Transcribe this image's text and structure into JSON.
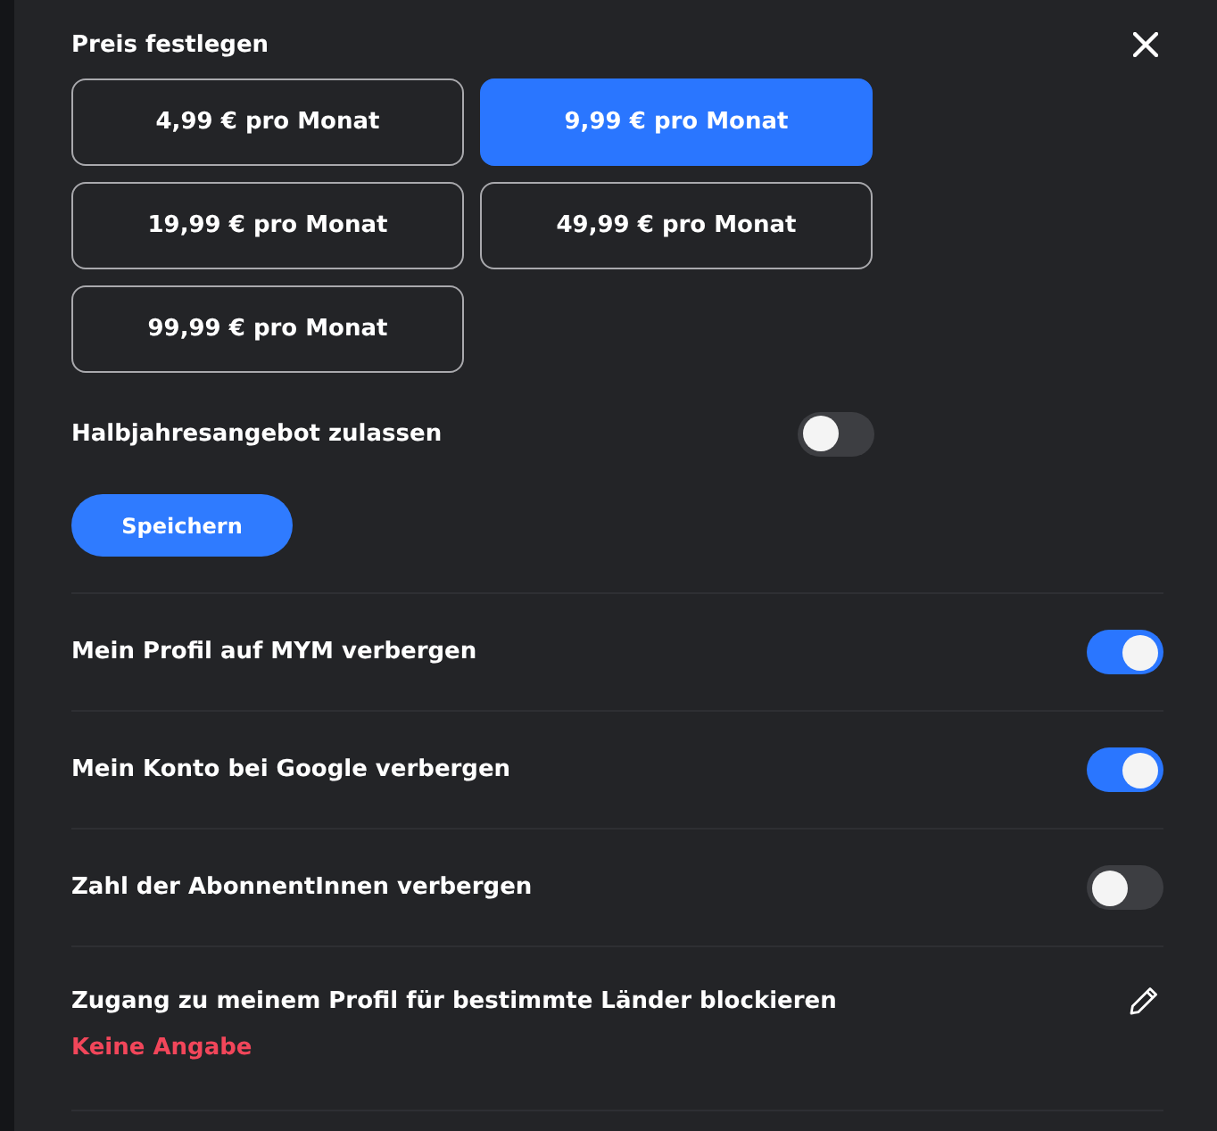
{
  "price_section": {
    "title": "Preis festlegen",
    "options": [
      {
        "label": "4,99 € pro Monat",
        "selected": false
      },
      {
        "label": "9,99 € pro Monat",
        "selected": true
      },
      {
        "label": "19,99 € pro Monat",
        "selected": false
      },
      {
        "label": "49,99 € pro Monat",
        "selected": false
      },
      {
        "label": "99,99 € pro Monat",
        "selected": false
      }
    ],
    "half_year_offer": {
      "label": "Halbjahresangebot zulassen",
      "on": false
    },
    "save_button": "Speichern"
  },
  "settings": [
    {
      "label": "Mein Profil auf MYM verbergen",
      "on": true
    },
    {
      "label": "Mein Konto bei Google verbergen",
      "on": true
    },
    {
      "label": "Zahl der AbonnentInnen verbergen",
      "on": false
    }
  ],
  "country_block": {
    "label": "Zugang zu meinem Profil für bestimmte Länder blockieren",
    "value": "Keine Angabe"
  }
}
